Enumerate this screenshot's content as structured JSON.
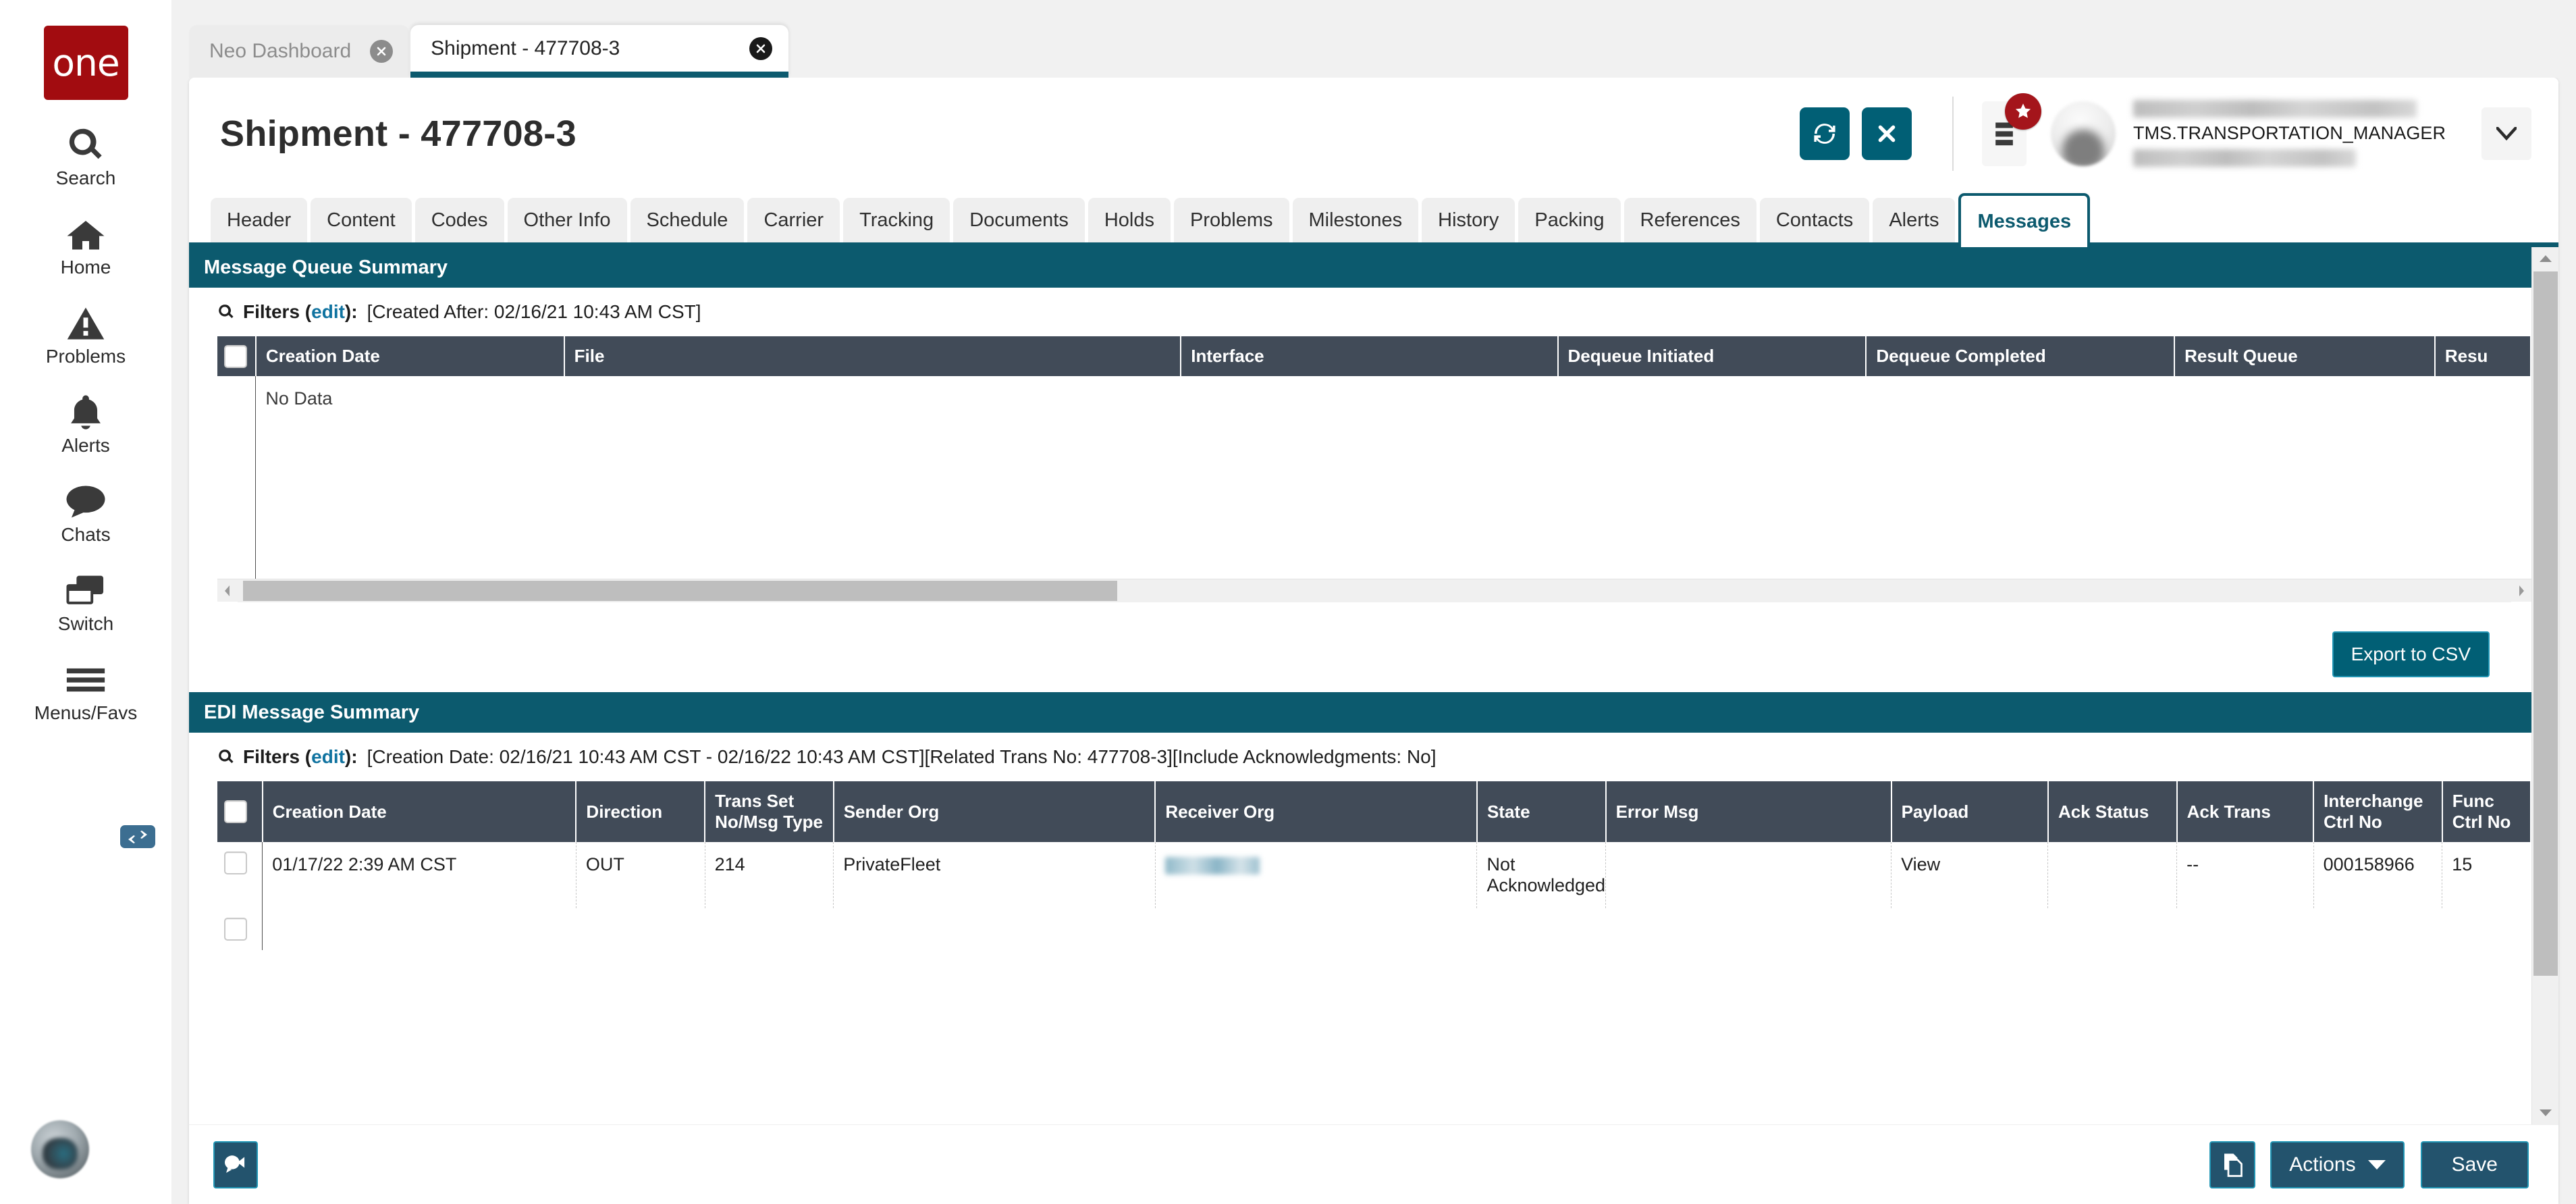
{
  "app": {
    "brand": "one"
  },
  "rail": {
    "items": [
      {
        "label": "Search",
        "icon": "search-icon"
      },
      {
        "label": "Home",
        "icon": "home-icon"
      },
      {
        "label": "Problems",
        "icon": "warning-triangle-icon"
      },
      {
        "label": "Alerts",
        "icon": "bell-icon"
      },
      {
        "label": "Chats",
        "icon": "chat-bubble-icon"
      },
      {
        "label": "Switch",
        "icon": "switch-windows-icon"
      },
      {
        "label": "Menus/Favs",
        "icon": "hamburger-icon"
      }
    ]
  },
  "browser_tabs": [
    {
      "title": "Neo Dashboard",
      "active": false
    },
    {
      "title": "Shipment - 477708-3",
      "active": true
    }
  ],
  "header": {
    "title": "Shipment - 477708-3",
    "refresh_icon": "refresh-icon",
    "close_icon": "close-x-icon",
    "menus_favs_icon": "menu-list-icon",
    "favs_badge_icon": "star-icon",
    "user_login": "TMS.TRANSPORTATION_MANAGER",
    "user_chevron_icon": "chevron-down-icon"
  },
  "entity_tabs": [
    {
      "label": "Header",
      "active": false
    },
    {
      "label": "Content",
      "active": false
    },
    {
      "label": "Codes",
      "active": false
    },
    {
      "label": "Other Info",
      "active": false
    },
    {
      "label": "Schedule",
      "active": false
    },
    {
      "label": "Carrier",
      "active": false
    },
    {
      "label": "Tracking",
      "active": false
    },
    {
      "label": "Documents",
      "active": false
    },
    {
      "label": "Holds",
      "active": false
    },
    {
      "label": "Problems",
      "active": false
    },
    {
      "label": "Milestones",
      "active": false
    },
    {
      "label": "History",
      "active": false
    },
    {
      "label": "Packing",
      "active": false
    },
    {
      "label": "References",
      "active": false
    },
    {
      "label": "Contacts",
      "active": false
    },
    {
      "label": "Alerts",
      "active": false
    },
    {
      "label": "Messages",
      "active": true
    }
  ],
  "message_queue": {
    "section_title": "Message Queue Summary",
    "filters_label": "Filters (",
    "filters_edit": "edit",
    "filters_label_end": "):",
    "filters_value": "[Created After: 02/16/21 10:43 AM CST]",
    "columns": [
      "Creation Date",
      "File",
      "Interface",
      "Dequeue Initiated",
      "Dequeue Completed",
      "Result Queue",
      "Resu"
    ],
    "empty_text": "No Data",
    "export_label": "Export to CSV"
  },
  "edi_summary": {
    "section_title": "EDI Message Summary",
    "filters_label": "Filters (",
    "filters_edit": "edit",
    "filters_label_end": "):",
    "filters_value": "[Creation Date: 02/16/21 10:43 AM CST - 02/16/22 10:43 AM CST][Related Trans No: 477708-3][Include Acknowledgments: No]",
    "columns": [
      "Creation Date",
      "Direction",
      "Trans Set No/Msg Type",
      "Sender Org",
      "Receiver Org",
      "State",
      "Error Msg",
      "Payload",
      "Ack Status",
      "Ack Trans",
      "Interchange Ctrl No",
      "Func Ctrl No"
    ],
    "rows": [
      {
        "creation_date": "01/17/22 2:39 AM CST",
        "direction": "OUT",
        "trans_set": "214",
        "sender_org": "PrivateFleet",
        "receiver_org": "",
        "state": "Not Acknowledged",
        "error_msg": "",
        "payload": "View",
        "ack_status": "",
        "ack_trans": "--",
        "interchange_ctrl_no": "000158966",
        "func_ctrl_no": "15"
      }
    ]
  },
  "footer": {
    "chat_icon": "chat-bubble-send-icon",
    "copy_icon": "copy-document-icon",
    "actions_label": "Actions",
    "actions_caret_icon": "caret-down-icon",
    "save_label": "Save"
  },
  "colors": {
    "brand_red": "#a20c10",
    "teal": "#0c5a6e",
    "teal_button": "#015f75",
    "navy_button": "#23536d",
    "table_header": "#414b58",
    "link": "#1073a0"
  }
}
